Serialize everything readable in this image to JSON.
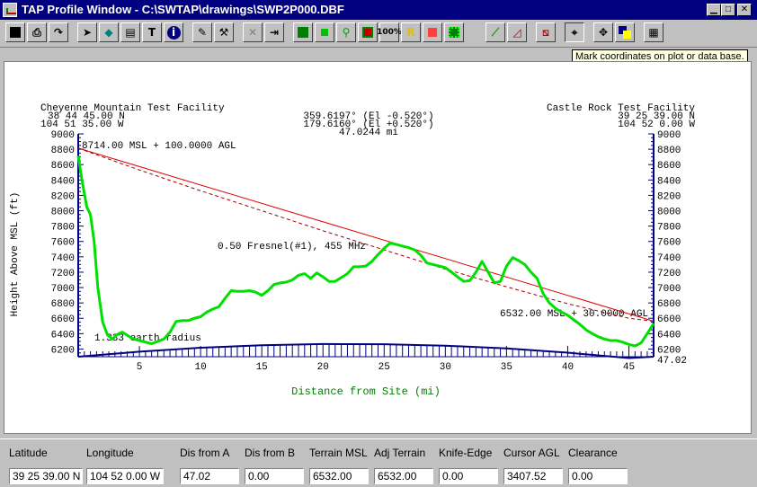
{
  "window": {
    "title": "TAP Profile Window - C:\\SWTAP\\drawings\\SWP2P000.DBF"
  },
  "tooltip": "Mark coordinates on plot or data base.",
  "toolbar": {
    "t_label": "T",
    "info_label": "i",
    "zoom_label": "100%",
    "r_label": "R"
  },
  "site_a": {
    "name": "Cheyenne Mountain Test Facility",
    "lat": "38 44 45.00 N",
    "lon": "104 51 35.00 W",
    "label": "8714.00 MSL + 100.0000 AGL"
  },
  "site_b": {
    "name": "Castle Rock Test Facility",
    "lat": "39 25 39.00 N",
    "lon": "104 52 0.00 W",
    "label": "6532.00 MSL + 30.0000 AGL"
  },
  "path": {
    "az1": "359.6197° (El -0.520°)",
    "az2": "179.6160° (El +0.520°)",
    "distance": "47.0244 mi"
  },
  "annotations": {
    "fresnel": "0.50 Fresnel(#1), 455 MHz",
    "earth": "1.333 earth radius",
    "end_distance": "47.02"
  },
  "chart_data": {
    "type": "line",
    "xlabel": "Distance from Site (mi)",
    "ylabel": "Height Above MSL (ft)",
    "xlim": [
      0,
      47.02
    ],
    "ylim": [
      6100,
      9000
    ],
    "xticks": [
      5,
      10,
      15,
      20,
      25,
      30,
      35,
      40,
      45
    ],
    "yticks": [
      6200,
      6400,
      6600,
      6800,
      7000,
      7200,
      7400,
      7600,
      7800,
      8000,
      8200,
      8400,
      8600,
      8800,
      9000
    ],
    "colors": {
      "terrain": "#00e000",
      "los": "#e00000",
      "fresnel": "#a00000",
      "earth": "#000080",
      "axis_label": "#008000"
    },
    "series": [
      {
        "name": "terrain",
        "x": [
          0,
          0.3,
          0.7,
          1.0,
          1.3,
          1.6,
          2.0,
          2.4,
          2.8,
          3.2,
          3.6,
          4.0,
          4.5,
          5.0,
          5.5,
          6.0,
          6.5,
          7.0,
          7.5,
          8.0,
          8.5,
          9.0,
          9.5,
          10.0,
          10.5,
          11.0,
          11.5,
          12.0,
          12.5,
          13.0,
          13.5,
          14.0,
          14.5,
          15.0,
          15.5,
          16.0,
          16.5,
          17.0,
          17.5,
          18.0,
          18.5,
          19.0,
          19.5,
          20.0,
          20.5,
          21.0,
          21.5,
          22.0,
          22.5,
          23.0,
          23.5,
          24.0,
          24.5,
          25.0,
          25.5,
          26.0,
          26.5,
          27.0,
          27.5,
          28.0,
          28.5,
          29.0,
          29.5,
          30.0,
          30.5,
          31.0,
          31.5,
          32.0,
          32.5,
          33.0,
          33.5,
          34.0,
          34.5,
          35.0,
          35.5,
          36.0,
          36.5,
          37.0,
          37.5,
          38.0,
          38.5,
          39.0,
          39.5,
          40.0,
          40.5,
          41.0,
          41.5,
          42.0,
          42.5,
          43.0,
          43.5,
          44.0,
          44.5,
          45.0,
          45.5,
          46.0,
          46.5,
          47.02
        ],
        "y": [
          8714,
          8400,
          8050,
          7950,
          7600,
          7000,
          6550,
          6380,
          6330,
          6390,
          6420,
          6380,
          6330,
          6310,
          6290,
          6270,
          6300,
          6330,
          6420,
          6560,
          6570,
          6570,
          6600,
          6620,
          6680,
          6720,
          6750,
          6860,
          6960,
          6950,
          6950,
          6960,
          6940,
          6900,
          6960,
          7040,
          7060,
          7070,
          7100,
          7160,
          7180,
          7120,
          7190,
          7140,
          7080,
          7080,
          7130,
          7180,
          7270,
          7270,
          7280,
          7340,
          7430,
          7510,
          7580,
          7560,
          7540,
          7520,
          7490,
          7420,
          7320,
          7300,
          7280,
          7260,
          7200,
          7140,
          7080,
          7090,
          7200,
          7340,
          7200,
          7060,
          7080,
          7280,
          7390,
          7350,
          7300,
          7200,
          7120,
          6920,
          6800,
          6730,
          6680,
          6640,
          6580,
          6520,
          6450,
          6400,
          6360,
          6330,
          6310,
          6310,
          6290,
          6260,
          6240,
          6280,
          6400,
          6532
        ]
      },
      {
        "name": "line-of-sight",
        "x": [
          0,
          47.02
        ],
        "y": [
          8814,
          6562
        ]
      },
      {
        "name": "fresnel-0.5",
        "x": [
          0,
          5,
          10,
          15,
          20,
          25,
          30,
          35,
          40,
          45,
          47.02
        ],
        "y": [
          8814,
          8530,
          8260,
          8000,
          7740,
          7490,
          7240,
          7010,
          6790,
          6600,
          6562
        ]
      },
      {
        "name": "earth-bulge",
        "x": [
          0,
          5,
          10,
          15,
          20,
          25,
          30,
          35,
          40,
          45,
          47.02
        ],
        "y": [
          6100,
          6166,
          6217,
          6250,
          6265,
          6263,
          6244,
          6207,
          6153,
          6082,
          6100
        ]
      }
    ]
  },
  "status": {
    "fields": [
      {
        "label": "Latitude",
        "value": "39 25 39.00 N"
      },
      {
        "label": "Longitude",
        "value": "104 52 0.00 W"
      },
      {
        "label": "Dis from A",
        "value": "47.02"
      },
      {
        "label": "Dis from B",
        "value": "0.00"
      },
      {
        "label": "Terrain MSL",
        "value": "6532.00"
      },
      {
        "label": "Adj Terrain",
        "value": "6532.00"
      },
      {
        "label": "Knife-Edge",
        "value": "0.00"
      },
      {
        "label": "Cursor AGL",
        "value": "3407.52"
      },
      {
        "label": "Clearance",
        "value": "0.00"
      }
    ]
  }
}
